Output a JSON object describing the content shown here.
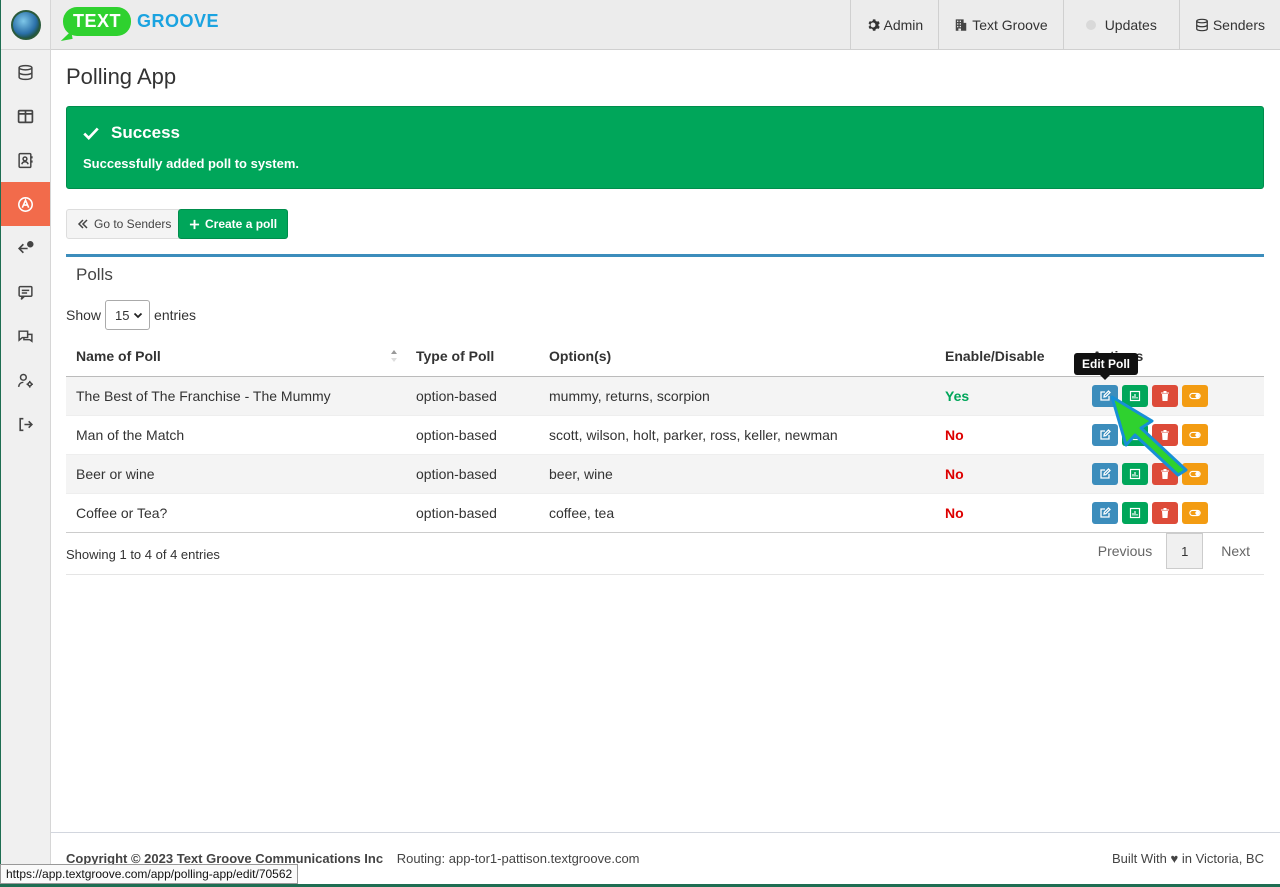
{
  "brand": {
    "text_part": "TEXT",
    "groove_part": "GROOVE"
  },
  "nav": {
    "admin": "Admin",
    "text_groove": "Text Groove",
    "updates": "Updates",
    "senders": "Senders"
  },
  "sidebar": {
    "items": [
      {
        "icon": "database-icon"
      },
      {
        "icon": "columns-icon"
      },
      {
        "icon": "contact-book-icon"
      },
      {
        "icon": "polling-app-icon",
        "active": true
      },
      {
        "icon": "reply-icon"
      },
      {
        "icon": "message-icon"
      },
      {
        "icon": "conversations-icon"
      },
      {
        "icon": "user-settings-icon"
      },
      {
        "icon": "logout-icon"
      }
    ]
  },
  "page": {
    "title": "Polling App"
  },
  "alert": {
    "title": "Success",
    "message": "Successfully added poll to system."
  },
  "buttons": {
    "go_to_senders": "Go to Senders",
    "create_poll": "Create a poll"
  },
  "polls": {
    "box_title": "Polls",
    "show_label": "Show",
    "entries_label": "entries",
    "page_length": "15",
    "columns": [
      "Name of Poll",
      "Type of Poll",
      "Option(s)",
      "Enable/Disable",
      "Actions"
    ],
    "rows": [
      {
        "name": "The Best of The Franchise - The Mummy",
        "type": "option-based",
        "options": "mummy, returns, scorpion",
        "enabled": "Yes"
      },
      {
        "name": "Man of the Match",
        "type": "option-based",
        "options": "scott, wilson, holt, parker, ross, keller, newman",
        "enabled": "No"
      },
      {
        "name": "Beer or wine",
        "type": "option-based",
        "options": "beer, wine",
        "enabled": "No"
      },
      {
        "name": "Coffee or Tea?",
        "type": "option-based",
        "options": "coffee, tea",
        "enabled": "No"
      }
    ],
    "info": "Showing 1 to 4 of 4 entries",
    "pagination": {
      "previous": "Previous",
      "current": "1",
      "next": "Next"
    }
  },
  "tooltip": "Edit Poll",
  "footer": {
    "copyright": "Copyright © 2023 Text Groove Communications Inc",
    "routing": "Routing: app-tor1-pattison.textgroove.com",
    "built_with": "Built With",
    "location": "in Victoria, BC"
  },
  "status_url": "https://app.textgroove.com/app/polling-app/edit/70562",
  "colors": {
    "success": "#00a65a",
    "primary": "#3c8dbc",
    "danger": "#dd4b39",
    "warning": "#f39c12",
    "sidebar_active": "#f26b4b"
  }
}
